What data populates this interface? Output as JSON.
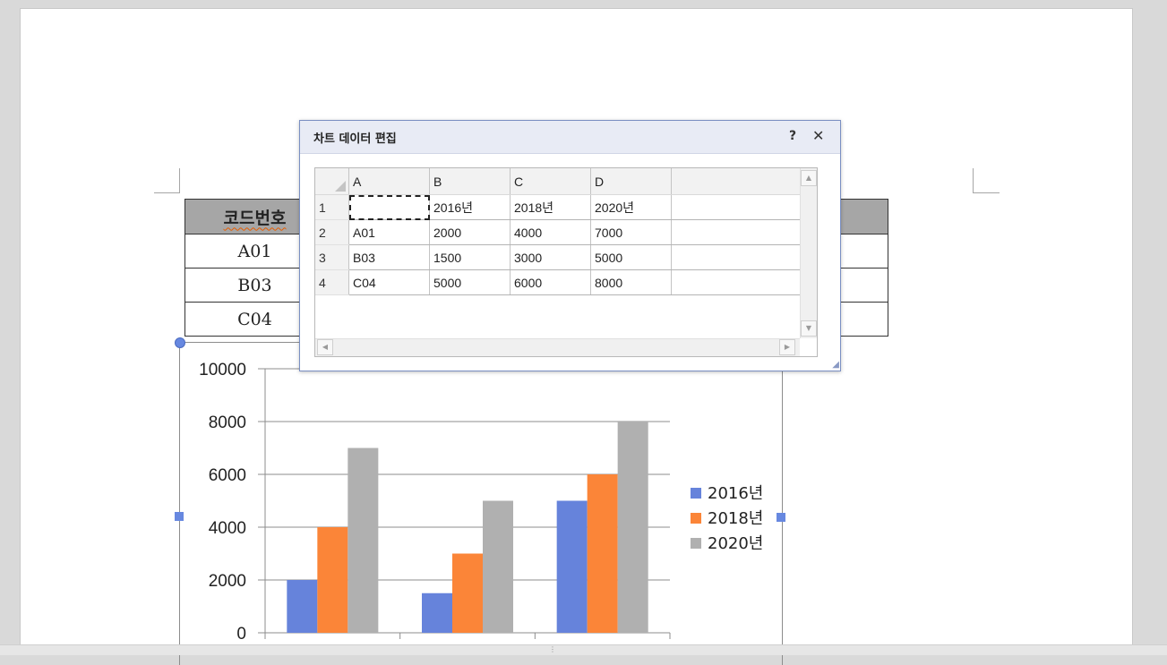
{
  "document": {
    "table": {
      "header": [
        "코드번호",
        ""
      ],
      "rows": [
        [
          "A01",
          ""
        ],
        [
          "B03",
          ""
        ],
        [
          "C04",
          ""
        ]
      ]
    }
  },
  "dialog": {
    "title": "차트 데이터 편집",
    "help_label": "?",
    "close_label": "✕",
    "grid": {
      "columns": [
        "A",
        "B",
        "C",
        "D",
        ""
      ],
      "rows": [
        {
          "num": "1",
          "cells": [
            "",
            "2016년",
            "2018년",
            "2020년",
            ""
          ]
        },
        {
          "num": "2",
          "cells": [
            "A01",
            "2000",
            "4000",
            "7000",
            ""
          ]
        },
        {
          "num": "3",
          "cells": [
            "B03",
            "1500",
            "3000",
            "5000",
            ""
          ]
        },
        {
          "num": "4",
          "cells": [
            "C04",
            "5000",
            "6000",
            "8000",
            ""
          ]
        }
      ]
    }
  },
  "chart_data": {
    "type": "bar",
    "categories": [
      "A01",
      "B03",
      "C04"
    ],
    "series": [
      {
        "name": "2016년",
        "values": [
          2000,
          1500,
          5000
        ],
        "color": "#6683db"
      },
      {
        "name": "2018년",
        "values": [
          4000,
          3000,
          6000
        ],
        "color": "#fb8538"
      },
      {
        "name": "2020년",
        "values": [
          7000,
          5000,
          8000
        ],
        "color": "#b0b0b0"
      }
    ],
    "ylim": [
      0,
      10000
    ],
    "yticks": [
      "0",
      "2000",
      "4000",
      "6000",
      "8000",
      "10000"
    ],
    "grid": true,
    "legend": "right",
    "category_labels_visible": false
  }
}
